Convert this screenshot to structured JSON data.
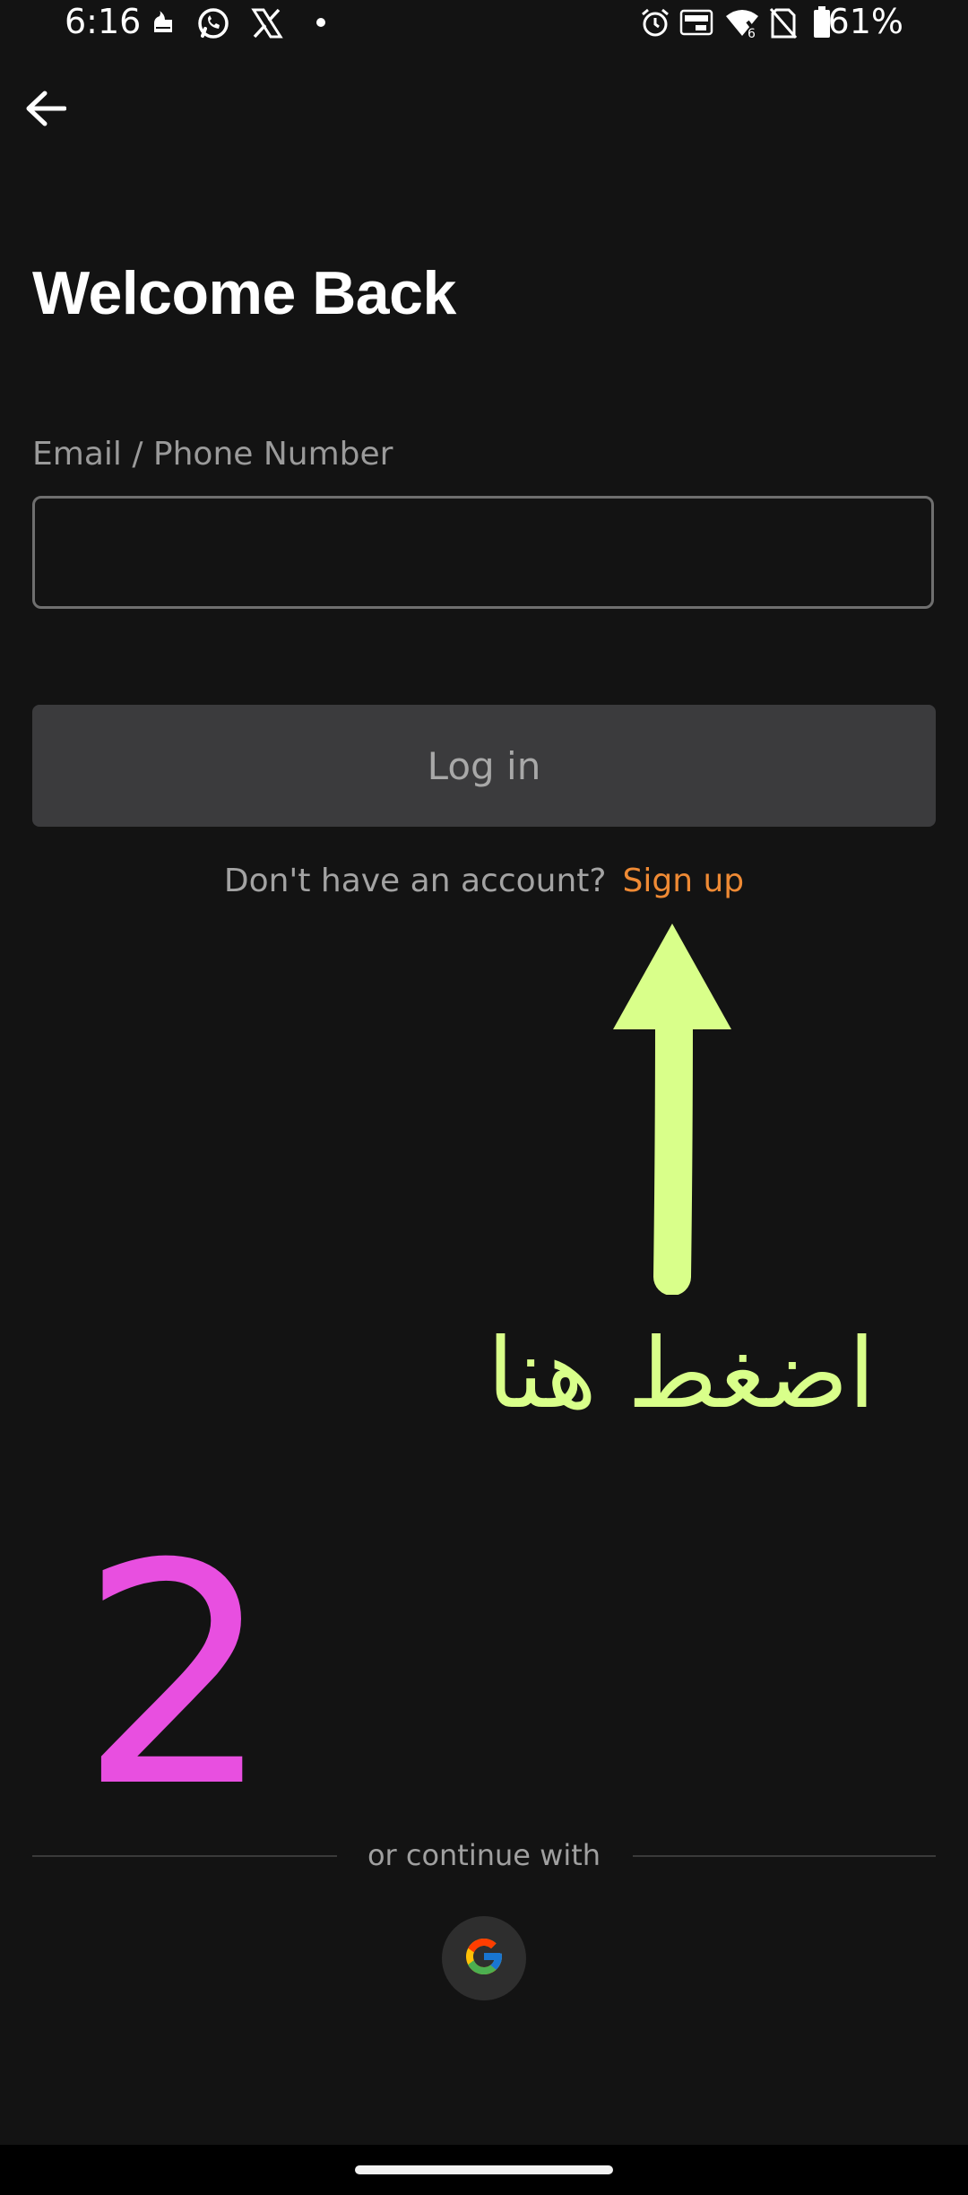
{
  "status_bar": {
    "time": "6:16",
    "battery_percent": "61%",
    "left_icons": [
      "mosque-notification-icon",
      "whatsapp-icon",
      "x-icon",
      "notification-dot-icon"
    ],
    "right_icons": [
      "alarm-icon",
      "auto-hz-icon",
      "wifi-6-icon",
      "no-sim-icon",
      "battery-icon"
    ]
  },
  "header": {
    "back_icon": "arrow-left-icon"
  },
  "main": {
    "title": "Welcome Back",
    "email_label": "Email / Phone Number",
    "email_value": "",
    "email_placeholder": "",
    "login_label": "Log in",
    "signup_prompt": "Don't have an account?",
    "signup_link": "Sign up"
  },
  "annotations": {
    "arabic_text": "اضغط هنا",
    "step_number": "2",
    "arrow_color": "#d9ff8a",
    "step_color": "#e84fe0"
  },
  "social": {
    "divider_text": "or continue with",
    "google_icon": "google-icon"
  },
  "colors": {
    "background": "#131313",
    "accent": "#ef8a34",
    "button_bg": "#3b3b3d"
  }
}
